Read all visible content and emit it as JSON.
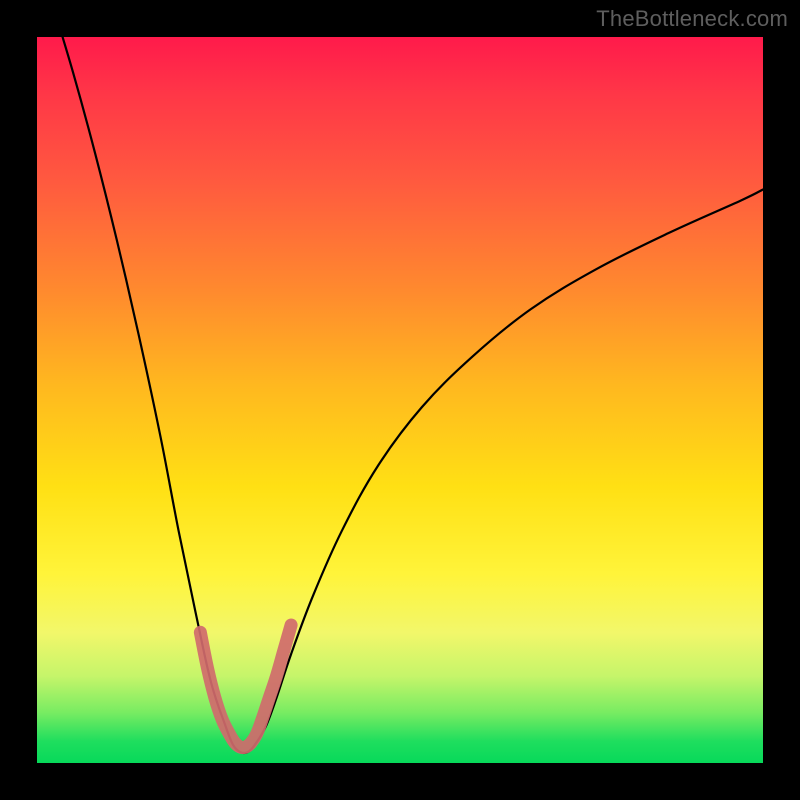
{
  "watermark": "TheBottleneck.com",
  "chart_data": {
    "type": "line",
    "title": "",
    "xlabel": "",
    "ylabel": "",
    "xlim": [
      0,
      100
    ],
    "ylim": [
      0,
      100
    ],
    "grid": false,
    "series": [
      {
        "name": "bottleneck-curve",
        "color": "#000000",
        "x": [
          2,
          5,
          8,
          11,
          14,
          17,
          19.5,
          22,
          24,
          26,
          27,
          28,
          29,
          30,
          31.5,
          33,
          35,
          38,
          42,
          47,
          53,
          60,
          68,
          77,
          87,
          97,
          100
        ],
        "values": [
          105,
          95,
          84,
          72,
          59,
          45,
          32,
          20,
          11,
          5,
          2.5,
          1.5,
          1.5,
          2.5,
          5,
          9,
          15,
          23,
          32,
          41,
          49,
          56,
          62.5,
          68,
          73,
          77.5,
          79
        ]
      },
      {
        "name": "sweet-spot-marker",
        "color": "#d06a6d",
        "x": [
          22.5,
          23.5,
          24.5,
          25.5,
          26.5,
          27.25,
          28,
          28.75,
          29.5,
          30.25,
          31,
          32,
          33,
          34,
          35
        ],
        "values": [
          18,
          13,
          9,
          6,
          4,
          2.8,
          2.2,
          2.2,
          2.8,
          4,
          6,
          9,
          12,
          15.5,
          19
        ]
      }
    ],
    "annotations": []
  }
}
